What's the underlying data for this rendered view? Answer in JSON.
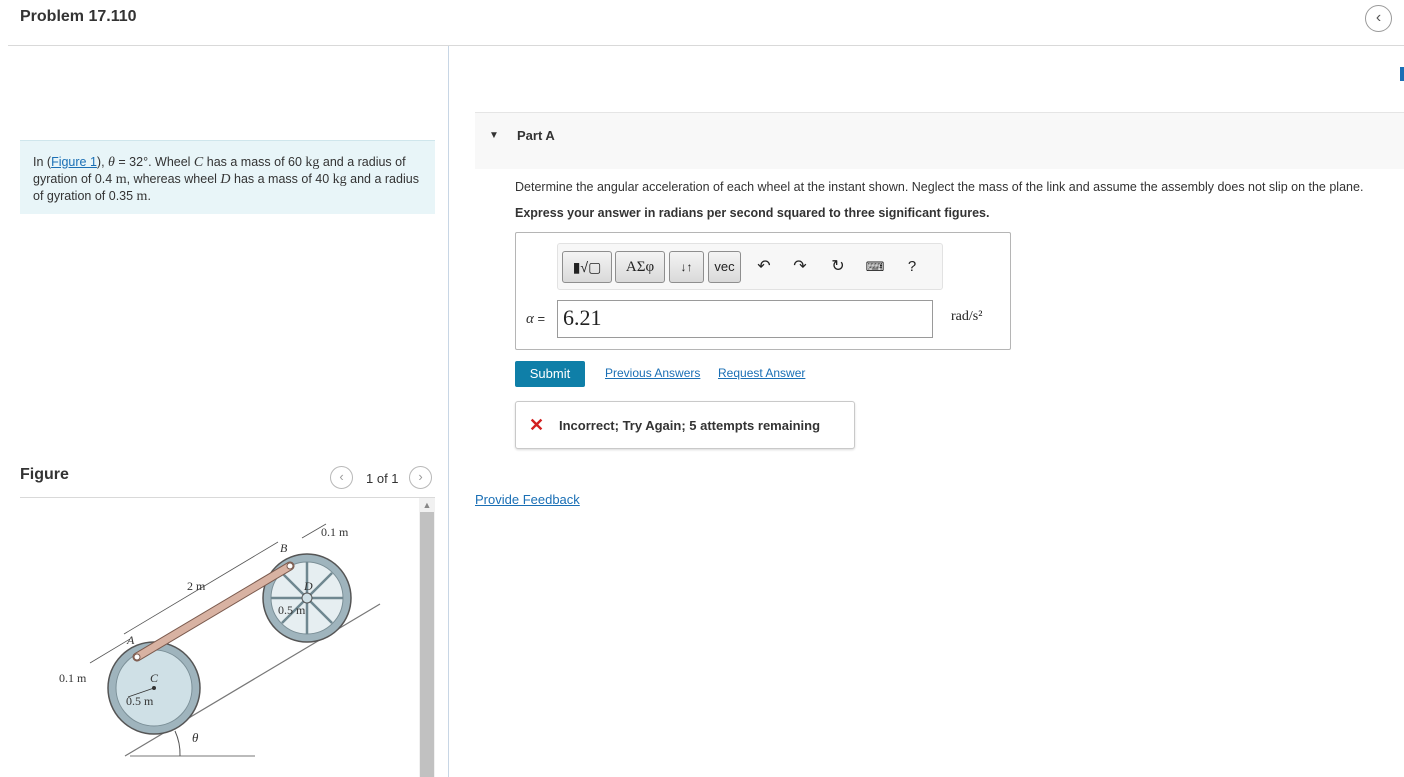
{
  "header": {
    "problem_title": "Problem 17.110",
    "collapse_icon": "chevron-left-icon"
  },
  "intro": {
    "prefix": "In (",
    "figure_link": "Figure 1",
    "after_link": "), ",
    "theta_sym": "θ",
    "theta_value": " = 32°. Wheel ",
    "wheel_c": "C",
    "c_mass_text": " has a mass of 60 ",
    "kg1": "kg",
    "c_radius_text": " and a radius of gyration of 0.4 ",
    "m1": "m",
    "whereas_text": ", whereas wheel ",
    "wheel_d": "D",
    "d_mass_text": " has a mass of 40 ",
    "kg2": "kg",
    "d_radius_text": " and a radius of gyration of 0.35 ",
    "m2": "m",
    "end": "."
  },
  "figure_panel": {
    "label": "Figure",
    "counter": "1 of 1",
    "prev_icon": "chevron-left-icon",
    "next_icon": "chevron-right-icon",
    "labels": {
      "top_offset": "0.1 m",
      "point_b": "B",
      "point_d": "D",
      "radius_d": "0.5 m",
      "link_length": "2 m",
      "point_a": "A",
      "left_offset": "0.1 m",
      "point_c": "C",
      "radius_c": "0.5 m",
      "angle": "θ"
    }
  },
  "part": {
    "title": "Part A",
    "question": "Determine the angular acceleration of each wheel at the instant shown. Neglect the mass of the link and assume the assembly does not slip on the plane.",
    "instruction": "Express your answer in radians per second squared to three significant figures."
  },
  "toolbar": {
    "templates_label": "▮√▢",
    "greek_label": "ΑΣφ",
    "sort_label": "↓↑",
    "vec_label": "vec",
    "undo_icon": "undo-icon",
    "redo_icon": "redo-icon",
    "reset_icon": "reset-icon",
    "keyboard_icon": "keyboard-icon",
    "help_label": "?"
  },
  "answer": {
    "variable": "α",
    "equals": " =",
    "value": "6.21",
    "unit": "rad/s²"
  },
  "actions": {
    "submit": "Submit",
    "previous_answers": "Previous Answers",
    "request_answer": "Request Answer"
  },
  "feedback": {
    "icon": "x-icon",
    "text": "Incorrect; Try Again; 5 attempts remaining"
  },
  "provide_feedback": "Provide Feedback",
  "colors": {
    "accent": "#0f7fa8",
    "link": "#1a6fb5",
    "error": "#d21f1f",
    "intro_bg": "#e8f5f8"
  }
}
